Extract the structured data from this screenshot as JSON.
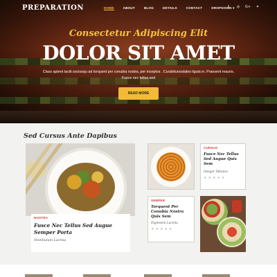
{
  "nav": {
    "logo": "PREPARATION",
    "items": [
      "HOME",
      "ABOUT",
      "BLOG",
      "DETAILS",
      "CONTACT",
      "DROPDOWN ▾"
    ],
    "social_icons": [
      "facebook-icon",
      "instagram-icon",
      "google-plus-icon",
      "twitter-icon"
    ],
    "social_glyphs": [
      "f",
      "◎",
      "G+",
      "✦"
    ],
    "accent_color": "#f5c23a"
  },
  "hero": {
    "subtitle": "Consectetur Adipiscing Elit",
    "title": "DOLOR SIT AMET",
    "description": "Class aptent taciti sociosqu ad torquent per conubia nostra, per inceptos . Curabitursodales ligula in. Praesent mauris. Fusce nec tellus sed",
    "button": "READ MORE"
  },
  "section": {
    "title": "Sed Cursus Ante Dapibus",
    "featured": {
      "tag": "NOSTRA",
      "title": "Fusce Nec Tellus Sed Augue Semper Porta",
      "author": "Vestibulum Lacinia"
    },
    "card1": {
      "tag": "CURSUS",
      "title": "Fusce Nec Tellus Sed Augue Quis Sem",
      "author": "Integer Dibunec",
      "stars": "★★★★★"
    },
    "card2": {
      "tag": "SEMPER",
      "title": "Torquent Per Conubia Nostra Quis Sem",
      "author": "Dignissim Lacinia",
      "stars": "★★★★★"
    }
  }
}
